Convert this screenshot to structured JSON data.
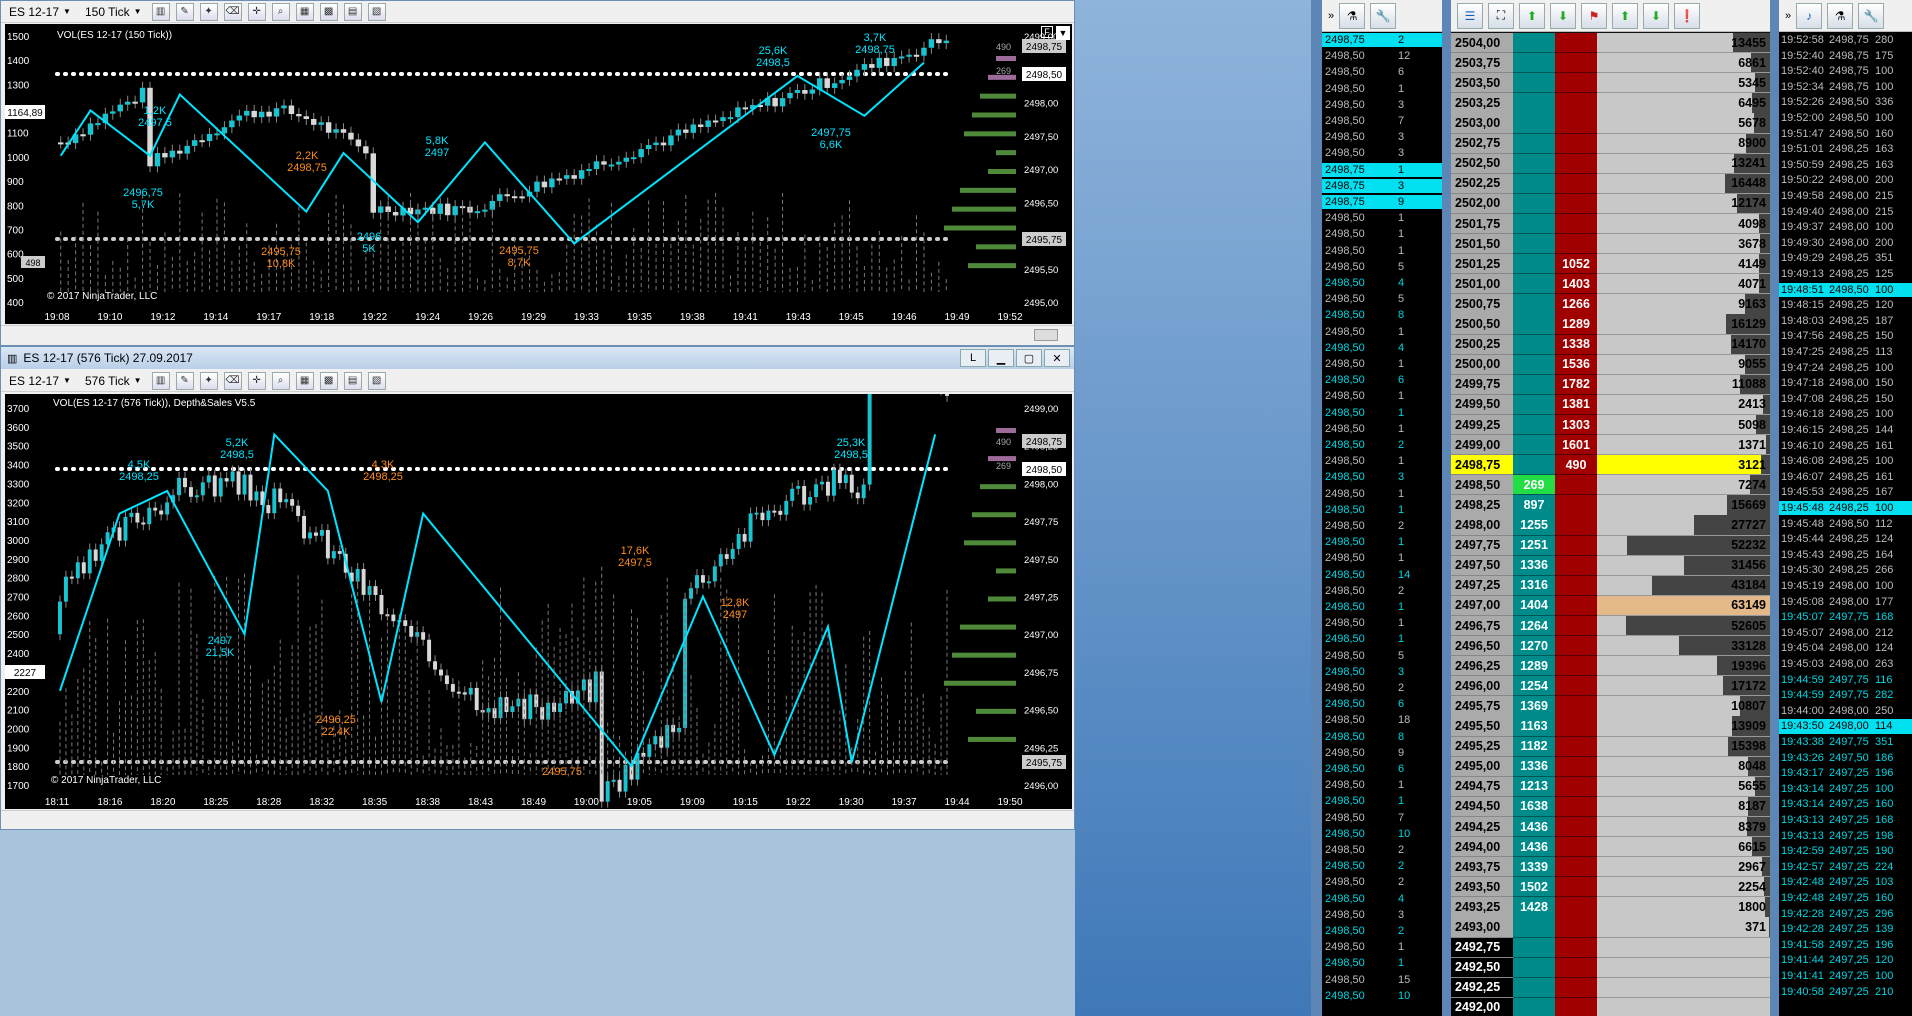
{
  "top_window": {
    "instrument": "ES 12-17",
    "bar_type": "150 Tick",
    "chart_label": "VOL(ES 12-17 (150 Tick))",
    "copyright": "© 2017 NinjaTrader, LLC",
    "f_button": "F",
    "left_axis": [
      "1500",
      "1400",
      "1300",
      "1200",
      "1100",
      "1000",
      "900",
      "800",
      "700",
      "600",
      "500",
      "400"
    ],
    "left_current": "1164,89",
    "left_vol": "498",
    "right_axis": [
      "2499,00",
      "2498,50",
      "2498,00",
      "2497,50",
      "2497,00",
      "2496,50",
      "2496,00",
      "2495,50",
      "2495,00"
    ],
    "right_badges": [
      "2498,75",
      "2498,50",
      "2495,75"
    ],
    "time_axis": [
      "19:08",
      "19:10",
      "19:12",
      "19:14",
      "19:17",
      "19:18",
      "19:22",
      "19:24",
      "19:26",
      "19:29",
      "19:33",
      "19:35",
      "19:38",
      "19:41",
      "19:43",
      "19:45",
      "19:46",
      "19:49",
      "19:52"
    ],
    "annotations": [
      {
        "t": "1,2K",
        "c": "cyan"
      },
      {
        "t": "2497,5",
        "c": "cyan"
      },
      {
        "t": "2496,75",
        "c": "cyan"
      },
      {
        "t": "5,7K",
        "c": "cyan"
      },
      {
        "t": "2,2K",
        "c": "orange"
      },
      {
        "t": "2498,75",
        "c": "orange"
      },
      {
        "t": "2495,75",
        "c": "orange"
      },
      {
        "t": "10,8K",
        "c": "orange"
      },
      {
        "t": "2496",
        "c": "cyan"
      },
      {
        "t": "5K",
        "c": "cyan"
      },
      {
        "t": "5,8K",
        "c": "cyan"
      },
      {
        "t": "2497",
        "c": "cyan"
      },
      {
        "t": "2495,75",
        "c": "orange"
      },
      {
        "t": "8,7K",
        "c": "orange"
      },
      {
        "t": "25,6K",
        "c": "cyan"
      },
      {
        "t": "2498,5",
        "c": "cyan"
      },
      {
        "t": "3,7K",
        "c": "cyan"
      },
      {
        "t": "2498,75",
        "c": "cyan"
      },
      {
        "t": "2497,75",
        "c": "cyan"
      },
      {
        "t": "6,6K",
        "c": "cyan"
      }
    ],
    "side_vols": [
      "490",
      "269"
    ]
  },
  "bottom_window": {
    "title": "ES 12-17 (576 Tick)  27.09.2017",
    "instrument": "ES 12-17",
    "bar_type": "576 Tick",
    "l_button": "L",
    "chart_label": "VOL(ES 12-17 (576 Tick)), Depth&Sales V5.5",
    "copyright": "© 2017 NinjaTrader, LLC",
    "left_axis": [
      "3700",
      "3600",
      "3500",
      "3400",
      "3300",
      "3200",
      "3100",
      "3000",
      "2900",
      "2800",
      "2700",
      "2600",
      "2500",
      "2400",
      "2300",
      "2200",
      "2100",
      "2000",
      "1900",
      "1800",
      "1700"
    ],
    "left_current": "2227",
    "right_axis": [
      "2499,00",
      "2498,25",
      "2498,00",
      "2497,75",
      "2497,50",
      "2497,25",
      "2497,00",
      "2496,75",
      "2496,50",
      "2496,25",
      "2496,00"
    ],
    "right_badges": [
      "2498,75",
      "2498,50",
      "2495,75"
    ],
    "time_axis": [
      "18:11",
      "18:16",
      "18:20",
      "18:25",
      "18:28",
      "18:32",
      "18:35",
      "18:38",
      "18:43",
      "18:49",
      "19:00",
      "19:05",
      "19:09",
      "19:15",
      "19:22",
      "19:30",
      "19:37",
      "19:44",
      "19:50"
    ],
    "annotations": [
      {
        "t": "4,5K",
        "c": "cyan"
      },
      {
        "t": "2498,25",
        "c": "cyan"
      },
      {
        "t": "5,2K",
        "c": "cyan"
      },
      {
        "t": "2498,5",
        "c": "cyan"
      },
      {
        "t": "2497",
        "c": "cyan"
      },
      {
        "t": "21,5K",
        "c": "cyan"
      },
      {
        "t": "4,3K",
        "c": "orange"
      },
      {
        "t": "2498,25",
        "c": "orange"
      },
      {
        "t": "2496,25",
        "c": "orange"
      },
      {
        "t": "22,4K",
        "c": "orange"
      },
      {
        "t": "17,6K",
        "c": "orange"
      },
      {
        "t": "2497,5",
        "c": "orange"
      },
      {
        "t": "2495,75",
        "c": "orange"
      },
      {
        "t": "12,8K",
        "c": "orange"
      },
      {
        "t": "2497",
        "c": "orange"
      },
      {
        "t": "25,3K",
        "c": "cyan"
      },
      {
        "t": "2498,5",
        "c": "cyan"
      }
    ],
    "side_vols": [
      "490",
      "269"
    ]
  },
  "tns_left": {
    "rows": [
      [
        "2498,75",
        "2"
      ],
      [
        "2498,50",
        "12"
      ],
      [
        "2498,50",
        "6"
      ],
      [
        "2498,50",
        "1"
      ],
      [
        "2498,50",
        "3"
      ],
      [
        "2498,50",
        "7"
      ],
      [
        "2498,50",
        "3"
      ],
      [
        "2498,50",
        "3"
      ],
      [
        "2498,75",
        "1"
      ],
      [
        "2498,75",
        "3"
      ],
      [
        "2498,75",
        "9"
      ],
      [
        "2498,50",
        "1"
      ],
      [
        "2498,50",
        "1"
      ],
      [
        "2498,50",
        "1"
      ],
      [
        "2498,50",
        "5"
      ],
      [
        "2498,50",
        "4"
      ],
      [
        "2498,50",
        "5"
      ],
      [
        "2498,50",
        "8"
      ],
      [
        "2498,50",
        "1"
      ],
      [
        "2498,50",
        "4"
      ],
      [
        "2498,50",
        "1"
      ],
      [
        "2498,50",
        "6"
      ],
      [
        "2498,50",
        "1"
      ],
      [
        "2498,50",
        "1"
      ],
      [
        "2498,50",
        "1"
      ],
      [
        "2498,50",
        "2"
      ],
      [
        "2498,50",
        "1"
      ],
      [
        "2498,50",
        "3"
      ],
      [
        "2498,50",
        "1"
      ],
      [
        "2498,50",
        "1"
      ],
      [
        "2498,50",
        "2"
      ],
      [
        "2498,50",
        "1"
      ],
      [
        "2498,50",
        "1"
      ],
      [
        "2498,50",
        "14"
      ],
      [
        "2498,50",
        "2"
      ],
      [
        "2498,50",
        "1"
      ],
      [
        "2498,50",
        "1"
      ],
      [
        "2498,50",
        "1"
      ],
      [
        "2498,50",
        "5"
      ],
      [
        "2498,50",
        "3"
      ],
      [
        "2498,50",
        "2"
      ],
      [
        "2498,50",
        "6"
      ],
      [
        "2498,50",
        "18"
      ],
      [
        "2498,50",
        "8"
      ],
      [
        "2498,50",
        "9"
      ],
      [
        "2498,50",
        "6"
      ],
      [
        "2498,50",
        "1"
      ],
      [
        "2498,50",
        "1"
      ],
      [
        "2498,50",
        "7"
      ],
      [
        "2498,50",
        "10"
      ],
      [
        "2498,50",
        "2"
      ],
      [
        "2498,50",
        "2"
      ],
      [
        "2498,50",
        "2"
      ],
      [
        "2498,50",
        "4"
      ],
      [
        "2498,50",
        "3"
      ],
      [
        "2498,50",
        "2"
      ],
      [
        "2498,50",
        "1"
      ],
      [
        "2498,50",
        "1"
      ],
      [
        "2498,50",
        "15"
      ],
      [
        "2498,50",
        "10"
      ]
    ],
    "highlight": [
      0,
      8,
      9,
      10
    ]
  },
  "dom": {
    "rows": [
      {
        "p": "2504,00",
        "bid": "",
        "ask": "",
        "vol": "13455"
      },
      {
        "p": "2503,75",
        "bid": "",
        "ask": "",
        "vol": "6861"
      },
      {
        "p": "2503,50",
        "bid": "",
        "ask": "",
        "vol": "5345"
      },
      {
        "p": "2503,25",
        "bid": "",
        "ask": "",
        "vol": "6495"
      },
      {
        "p": "2503,00",
        "bid": "",
        "ask": "",
        "vol": "5678"
      },
      {
        "p": "2502,75",
        "bid": "",
        "ask": "",
        "vol": "8900"
      },
      {
        "p": "2502,50",
        "bid": "",
        "ask": "",
        "vol": "13241"
      },
      {
        "p": "2502,25",
        "bid": "",
        "ask": "",
        "vol": "16448"
      },
      {
        "p": "2502,00",
        "bid": "",
        "ask": "",
        "vol": "12174"
      },
      {
        "p": "2501,75",
        "bid": "",
        "ask": "",
        "vol": "4098"
      },
      {
        "p": "2501,50",
        "bid": "",
        "ask": "",
        "vol": "3678"
      },
      {
        "p": "2501,25",
        "bid": "",
        "ask": "1052",
        "vol": "4149"
      },
      {
        "p": "2501,00",
        "bid": "",
        "ask": "1403",
        "vol": "4071"
      },
      {
        "p": "2500,75",
        "bid": "",
        "ask": "1266",
        "vol": "9163"
      },
      {
        "p": "2500,50",
        "bid": "",
        "ask": "1289",
        "vol": "16129"
      },
      {
        "p": "2500,25",
        "bid": "",
        "ask": "1338",
        "vol": "14170"
      },
      {
        "p": "2500,00",
        "bid": "",
        "ask": "1536",
        "vol": "9055"
      },
      {
        "p": "2499,75",
        "bid": "",
        "ask": "1782",
        "vol": "11088"
      },
      {
        "p": "2499,50",
        "bid": "",
        "ask": "1381",
        "vol": "2413"
      },
      {
        "p": "2499,25",
        "bid": "",
        "ask": "1303",
        "vol": "5098"
      },
      {
        "p": "2499,00",
        "bid": "",
        "ask": "1601",
        "vol": "1371"
      },
      {
        "p": "2498,75",
        "bid": "",
        "ask": "490",
        "vol": "3121",
        "cur": true
      },
      {
        "p": "2498,50",
        "bid": "269",
        "ask": "",
        "vol": "7274",
        "bidhl": true
      },
      {
        "p": "2498,25",
        "bid": "897",
        "ask": "",
        "vol": "15669"
      },
      {
        "p": "2498,00",
        "bid": "1255",
        "ask": "",
        "vol": "27727"
      },
      {
        "p": "2497,75",
        "bid": "1251",
        "ask": "",
        "vol": "52232"
      },
      {
        "p": "2497,50",
        "bid": "1336",
        "ask": "",
        "vol": "31456"
      },
      {
        "p": "2497,25",
        "bid": "1316",
        "ask": "",
        "vol": "43184"
      },
      {
        "p": "2497,00",
        "bid": "1404",
        "ask": "",
        "vol": "63149"
      },
      {
        "p": "2496,75",
        "bid": "1264",
        "ask": "",
        "vol": "52605"
      },
      {
        "p": "2496,50",
        "bid": "1270",
        "ask": "",
        "vol": "33128"
      },
      {
        "p": "2496,25",
        "bid": "1289",
        "ask": "",
        "vol": "19396"
      },
      {
        "p": "2496,00",
        "bid": "1254",
        "ask": "",
        "vol": "17172"
      },
      {
        "p": "2495,75",
        "bid": "1369",
        "ask": "",
        "vol": "10807"
      },
      {
        "p": "2495,50",
        "bid": "1163",
        "ask": "",
        "vol": "13909"
      },
      {
        "p": "2495,25",
        "bid": "1182",
        "ask": "",
        "vol": "15398"
      },
      {
        "p": "2495,00",
        "bid": "1336",
        "ask": "",
        "vol": "8048"
      },
      {
        "p": "2494,75",
        "bid": "1213",
        "ask": "",
        "vol": "5655"
      },
      {
        "p": "2494,50",
        "bid": "1638",
        "ask": "",
        "vol": "8187"
      },
      {
        "p": "2494,25",
        "bid": "1436",
        "ask": "",
        "vol": "8379"
      },
      {
        "p": "2494,00",
        "bid": "1436",
        "ask": "",
        "vol": "6615"
      },
      {
        "p": "2493,75",
        "bid": "1339",
        "ask": "",
        "vol": "2967"
      },
      {
        "p": "2493,50",
        "bid": "1502",
        "ask": "",
        "vol": "2254"
      },
      {
        "p": "2493,25",
        "bid": "1428",
        "ask": "",
        "vol": "1800"
      },
      {
        "p": "2493,00",
        "bid": "",
        "ask": "",
        "vol": "371"
      },
      {
        "p": "2492,75",
        "bid": "",
        "ask": "",
        "vol": ""
      },
      {
        "p": "2492,50",
        "bid": "",
        "ask": "",
        "vol": ""
      },
      {
        "p": "2492,25",
        "bid": "",
        "ask": "",
        "vol": ""
      },
      {
        "p": "2492,00",
        "bid": "",
        "ask": "",
        "vol": ""
      }
    ]
  },
  "tns_right": {
    "rows": [
      [
        "19:52:58",
        "2498,75",
        "280"
      ],
      [
        "19:52:40",
        "2498,75",
        "175"
      ],
      [
        "19:52:40",
        "2498,75",
        "100"
      ],
      [
        "19:52:34",
        "2498,75",
        "100"
      ],
      [
        "19:52:26",
        "2498,50",
        "336"
      ],
      [
        "19:52:00",
        "2498,50",
        "100"
      ],
      [
        "19:51:47",
        "2498,50",
        "160"
      ],
      [
        "19:51:01",
        "2498,25",
        "163"
      ],
      [
        "19:50:59",
        "2498,25",
        "163"
      ],
      [
        "19:50:22",
        "2498,00",
        "200"
      ],
      [
        "19:49:58",
        "2498,00",
        "215"
      ],
      [
        "19:49:40",
        "2498,00",
        "215"
      ],
      [
        "19:49:37",
        "2498,00",
        "100"
      ],
      [
        "19:49:30",
        "2498,00",
        "200"
      ],
      [
        "19:49:29",
        "2498,25",
        "351"
      ],
      [
        "19:49:13",
        "2498,25",
        "125"
      ],
      [
        "19:48:51",
        "2498,50",
        "100"
      ],
      [
        "19:48:15",
        "2498,25",
        "120"
      ],
      [
        "19:48:03",
        "2498,25",
        "187"
      ],
      [
        "19:47:56",
        "2498,25",
        "150"
      ],
      [
        "19:47:25",
        "2498,25",
        "113"
      ],
      [
        "19:47:24",
        "2498,25",
        "100"
      ],
      [
        "19:47:18",
        "2498,00",
        "150"
      ],
      [
        "19:47:08",
        "2498,25",
        "150"
      ],
      [
        "19:46:18",
        "2498,25",
        "100"
      ],
      [
        "19:46:15",
        "2498,25",
        "144"
      ],
      [
        "19:46:10",
        "2498,25",
        "161"
      ],
      [
        "19:46:08",
        "2498,25",
        "100"
      ],
      [
        "19:46:07",
        "2498,25",
        "161"
      ],
      [
        "19:45:53",
        "2498,25",
        "167"
      ],
      [
        "19:45:48",
        "2498,25",
        "100"
      ],
      [
        "19:45:48",
        "2498,50",
        "112"
      ],
      [
        "19:45:44",
        "2498,25",
        "124"
      ],
      [
        "19:45:43",
        "2498,25",
        "164"
      ],
      [
        "19:45:30",
        "2498,25",
        "266"
      ],
      [
        "19:45:19",
        "2498,00",
        "100"
      ],
      [
        "19:45:08",
        "2498,00",
        "177"
      ],
      [
        "19:45:07",
        "2497,75",
        "168"
      ],
      [
        "19:45:07",
        "2498,00",
        "212"
      ],
      [
        "19:45:04",
        "2498,00",
        "124"
      ],
      [
        "19:45:03",
        "2498,00",
        "263"
      ],
      [
        "19:44:59",
        "2497,75",
        "116"
      ],
      [
        "19:44:59",
        "2497,75",
        "282"
      ],
      [
        "19:44:00",
        "2498,00",
        "250"
      ],
      [
        "19:43:50",
        "2498,00",
        "114"
      ],
      [
        "19:43:38",
        "2497,75",
        "351"
      ],
      [
        "19:43:26",
        "2497,50",
        "186"
      ],
      [
        "19:43:17",
        "2497,25",
        "196"
      ],
      [
        "19:43:14",
        "2497,25",
        "100"
      ],
      [
        "19:43:14",
        "2497,25",
        "160"
      ],
      [
        "19:43:13",
        "2497,25",
        "168"
      ],
      [
        "19:43:13",
        "2497,25",
        "198"
      ],
      [
        "19:42:59",
        "2497,25",
        "190"
      ],
      [
        "19:42:57",
        "2497,25",
        "224"
      ],
      [
        "19:42:48",
        "2497,25",
        "103"
      ],
      [
        "19:42:48",
        "2497,25",
        "160"
      ],
      [
        "19:42:28",
        "2497,25",
        "296"
      ],
      [
        "19:42:28",
        "2497,25",
        "139"
      ],
      [
        "19:41:58",
        "2497,25",
        "196"
      ],
      [
        "19:41:44",
        "2497,25",
        "120"
      ],
      [
        "19:41:41",
        "2497,25",
        "100"
      ],
      [
        "19:40:58",
        "2497,25",
        "210"
      ]
    ],
    "highlight": [
      16,
      30,
      44
    ]
  },
  "colors": {
    "cyan": "#00e5ff",
    "orange": "#ff8c1a",
    "dom_bid": "#008b8b",
    "dom_ask": "#a00000",
    "current": "#ffff00"
  }
}
